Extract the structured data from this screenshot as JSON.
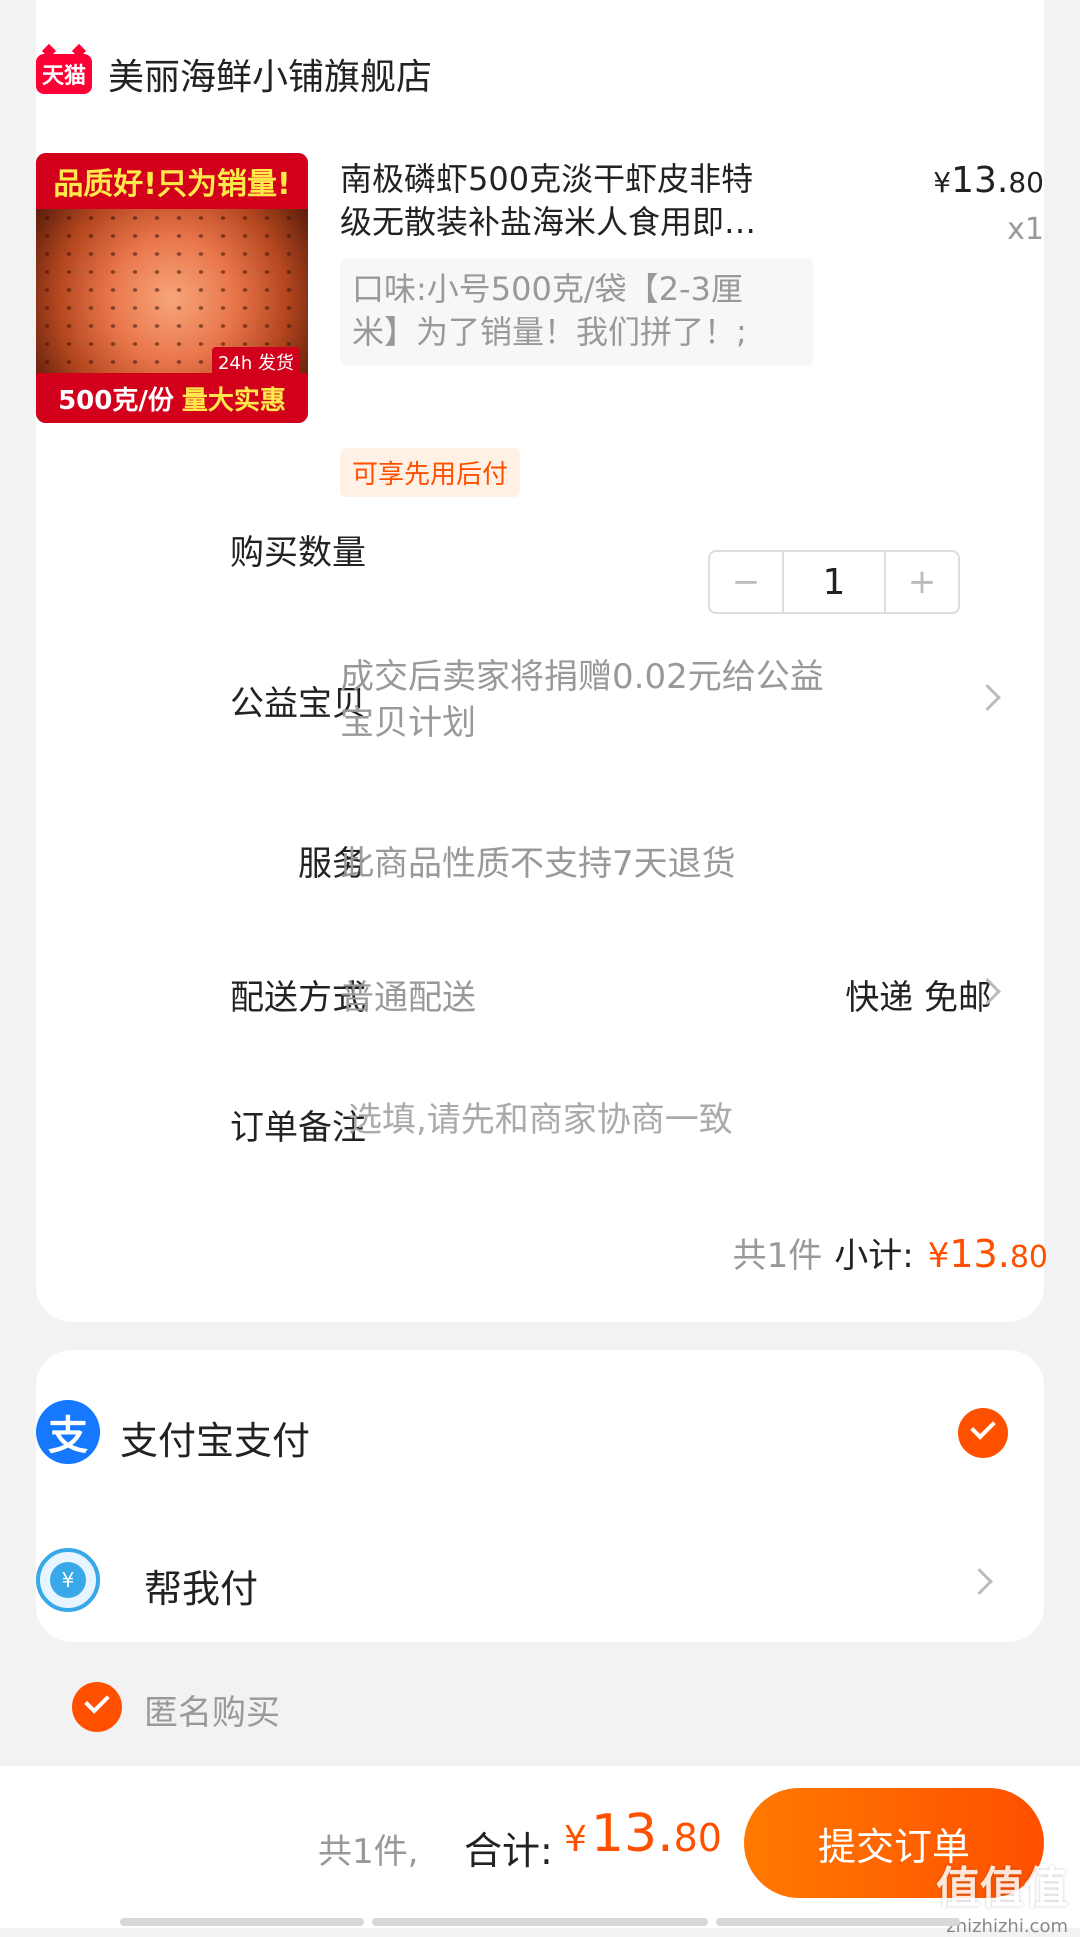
{
  "shop": {
    "badge": "天猫",
    "name": "美丽海鲜小铺旗舰店"
  },
  "product": {
    "image": {
      "top_text": "品质好!只为销量!",
      "tag": "24h 发货",
      "bottom_text": "500克/份",
      "bottom_highlight": "量大实惠"
    },
    "title_line1": "南极磷虾500克淡干虾皮非特",
    "title_line2": "级无散装补盐海米人食用即…",
    "price_symbol": "¥",
    "price_int": "13.",
    "price_dec": "80",
    "quantity": "x1",
    "sku_line1": "口味:小号500克/袋【2-3厘",
    "sku_line2": "米】为了销量！我们拼了！;",
    "promo_badge": "可享先用后付"
  },
  "rows": {
    "quantity_label": "购买数量",
    "stepper": {
      "minus": "−",
      "value": "1",
      "plus": "+"
    },
    "charity_label": "公益宝贝",
    "charity_line1": "成交后卖家将捐赠0.02元给公益",
    "charity_line2": "宝贝计划",
    "service_label": "服务",
    "service_value": "此商品性质不支持7天退货",
    "shipping_label": "配送方式",
    "shipping_value": "普通配送",
    "shipping_right": "快递 免邮",
    "note_label": "订单备注",
    "note_placeholder": "选填,请先和商家协商一致"
  },
  "subtotal": {
    "count": "共1件",
    "label": "小计:",
    "symbol": "¥",
    "int": "13.",
    "dec": "80"
  },
  "payment": {
    "alipay_icon": "支",
    "alipay_label": "支付宝支付",
    "alipay_selected": true,
    "helppay_icon": "¥",
    "helppay_label": "帮我付"
  },
  "anonymous": {
    "label": "匿名购买",
    "checked": true
  },
  "footer": {
    "count": "共1件,",
    "total_label": "合计:",
    "symbol": "¥",
    "int": "13.",
    "dec": "80",
    "submit": "提交订单",
    "watermark": "值值值",
    "watermark_url": "zhizhizhi.com"
  },
  "colors": {
    "accent": "#ff5000",
    "alipay_blue": "#1677ff",
    "tmall_red": "#ff0036"
  }
}
